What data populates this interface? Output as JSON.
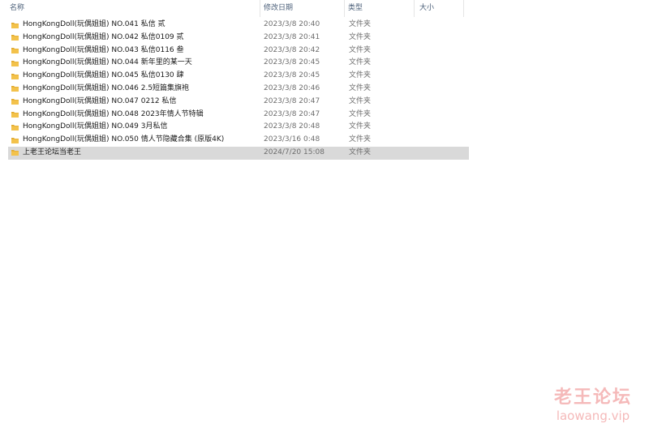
{
  "columns": {
    "name": "名称",
    "date": "修改日期",
    "type": "类型",
    "size": "大小"
  },
  "sort_indicator": "^",
  "rows": [
    {
      "name": "HongKongDoll(玩偶姐姐) NO.041 私信 贰",
      "date": "2023/3/8 20:40",
      "type": "文件夹"
    },
    {
      "name": "HongKongDoll(玩偶姐姐) NO.042 私信0109  贰",
      "date": "2023/3/8 20:41",
      "type": "文件夹"
    },
    {
      "name": "HongKongDoll(玩偶姐姐) NO.043 私信0116 叁",
      "date": "2023/3/8 20:42",
      "type": "文件夹"
    },
    {
      "name": "HongKongDoll(玩偶姐姐) NO.044 新年里的某一天",
      "date": "2023/3/8 20:45",
      "type": "文件夹"
    },
    {
      "name": "HongKongDoll(玩偶姐姐) NO.045 私信0130  肆",
      "date": "2023/3/8 20:45",
      "type": "文件夹"
    },
    {
      "name": "HongKongDoll(玩偶姐姐) NO.046 2.5短篇集旗袍",
      "date": "2023/3/8 20:46",
      "type": "文件夹"
    },
    {
      "name": "HongKongDoll(玩偶姐姐) NO.047 0212 私信",
      "date": "2023/3/8 20:47",
      "type": "文件夹"
    },
    {
      "name": "HongKongDoll(玩偶姐姐) NO.048 2023年情人节特辑",
      "date": "2023/3/8 20:47",
      "type": "文件夹"
    },
    {
      "name": "HongKongDoll(玩偶姐姐) NO.049 3月私信",
      "date": "2023/3/8 20:48",
      "type": "文件夹"
    },
    {
      "name": "HongKongDoll(玩偶姐姐) NO.050 情人节隐藏合集 (原版4K)",
      "date": "2023/3/16 0:48",
      "type": "文件夹"
    },
    {
      "name": "上老王论坛当老王",
      "date": "2024/7/20 15:08",
      "type": "文件夹",
      "selected": true
    }
  ],
  "icons": {
    "folder": "folder-icon",
    "folder_color": "#f3c24b",
    "folder_tab_color": "#e0a92e"
  },
  "colors": {
    "selected_row": "#d9d9d9",
    "header_text": "#4c607a",
    "watermark": "#f5b9b9"
  },
  "watermark": {
    "cn": "老王论坛",
    "en": "laowang.vip"
  }
}
